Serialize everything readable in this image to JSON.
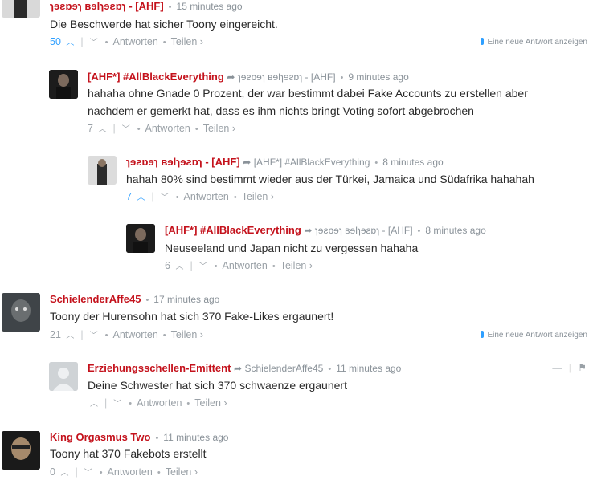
{
  "comments": [
    {
      "author": "ɿɘƨɒɘɿ ʙɘlɿɘƨɒɿ - [AHF]",
      "time": "15 minutes ago",
      "text": "Die Beschwerde hat sicher Toony eingereicht.",
      "votes": "50",
      "reply": "Antworten",
      "share": "Teilen ›",
      "new_reply": "Eine neue Antwort anzeigen"
    },
    {
      "author": "[AHF*] #AllBlackEverything",
      "reply_to": "ɿɘƨɒɘɿ ʙɘlɿɘƨɒɿ - [AHF]",
      "time": "9 minutes ago",
      "text": "hahaha ohne Gnade 0 Prozent, der war bestimmt dabei Fake Accounts zu erstellen aber nachdem er gemerkt hat, dass es ihm nichts bringt Voting sofort abgebrochen",
      "votes": "7",
      "reply": "Antworten",
      "share": "Teilen ›"
    },
    {
      "author": "ɿɘƨɒɘɿ ʙɘlɿɘƨɒɿ - [AHF]",
      "reply_to": "[AHF*] #AllBlackEverything",
      "time": "8 minutes ago",
      "text": "hahah 80% sind bestimmt wieder aus der Türkei, Jamaica und Südafrika hahahah",
      "votes": "7",
      "reply": "Antworten",
      "share": "Teilen ›"
    },
    {
      "author": "[AHF*] #AllBlackEverything",
      "reply_to": "ɿɘƨɒɘɿ ʙɘlɿɘƨɒɿ - [AHF]",
      "time": "8 minutes ago",
      "text": "Neuseeland und Japan nicht zu vergessen hahaha",
      "votes": "6",
      "reply": "Antworten",
      "share": "Teilen ›"
    },
    {
      "author": "SchielenderAffe45",
      "time": "17 minutes ago",
      "text": "Toony der Hurensohn hat sich 370 Fake-Likes ergaunert!",
      "votes": "21",
      "reply": "Antworten",
      "share": "Teilen ›",
      "new_reply": "Eine neue Antwort anzeigen"
    },
    {
      "author": "Erziehungsschellen-Emittent",
      "reply_to": "SchielenderAffe45",
      "time": "11 minutes ago",
      "text": "Deine Schwester hat sich 370 schwaenze ergaunert",
      "votes": "",
      "reply": "Antworten",
      "share": "Teilen ›",
      "controls": {
        "collapse": "—",
        "flag": "⚑"
      }
    },
    {
      "author": "King Orgasmus Two",
      "time": "11 minutes ago",
      "text": "Toony hat 370 Fakebots erstellt",
      "votes": "0",
      "reply": "Antworten",
      "share": "Teilen ›"
    }
  ],
  "icons": {
    "reply_arrow": "reply-arrow-icon",
    "upvote": "chevron-up-icon",
    "downvote": "chevron-down-icon",
    "flag": "flag-icon"
  },
  "colors": {
    "author": "#c4121c",
    "vote_active": "#2e9fff",
    "muted": "#8a9299"
  }
}
